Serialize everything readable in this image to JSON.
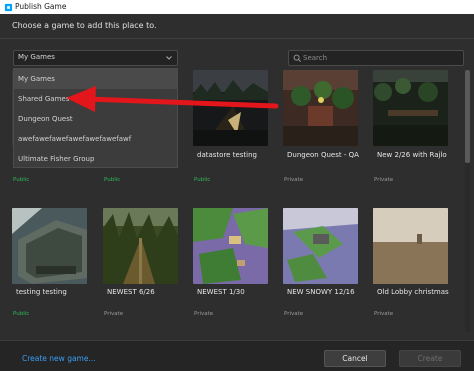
{
  "window": {
    "title": "Publish Game"
  },
  "instruction": "Choose a game to add this place to.",
  "dropdown": {
    "selected": "My Games",
    "options": [
      "My Games",
      "Shared Games",
      "Dungeon Quest",
      "awefawefawefawefawefawefawf",
      "Ultimate Fisher Group"
    ]
  },
  "search": {
    "placeholder": "Search"
  },
  "games": [
    {
      "name": "",
      "status": "Public"
    },
    {
      "name": "",
      "status": "Public"
    },
    {
      "name": "datastore testing",
      "status": "Public"
    },
    {
      "name": "Dungeon Quest - QA",
      "status": "Private"
    },
    {
      "name": "New 2/26 with Rajlo",
      "status": "Private"
    },
    {
      "name": "testing testing",
      "status": "Public"
    },
    {
      "name": "NEWEST 6/26",
      "status": "Private"
    },
    {
      "name": "NEWEST 1/30",
      "status": "Private"
    },
    {
      "name": "NEW SNOWY 12/16",
      "status": "Private"
    },
    {
      "name": "Old Lobby christmas",
      "status": "Private"
    }
  ],
  "footer": {
    "create_link": "Create new game...",
    "cancel": "Cancel",
    "create": "Create"
  },
  "colors": {
    "public": "#2fb75a",
    "link": "#3a9ff5",
    "annotation_arrow": "#e3161b"
  }
}
